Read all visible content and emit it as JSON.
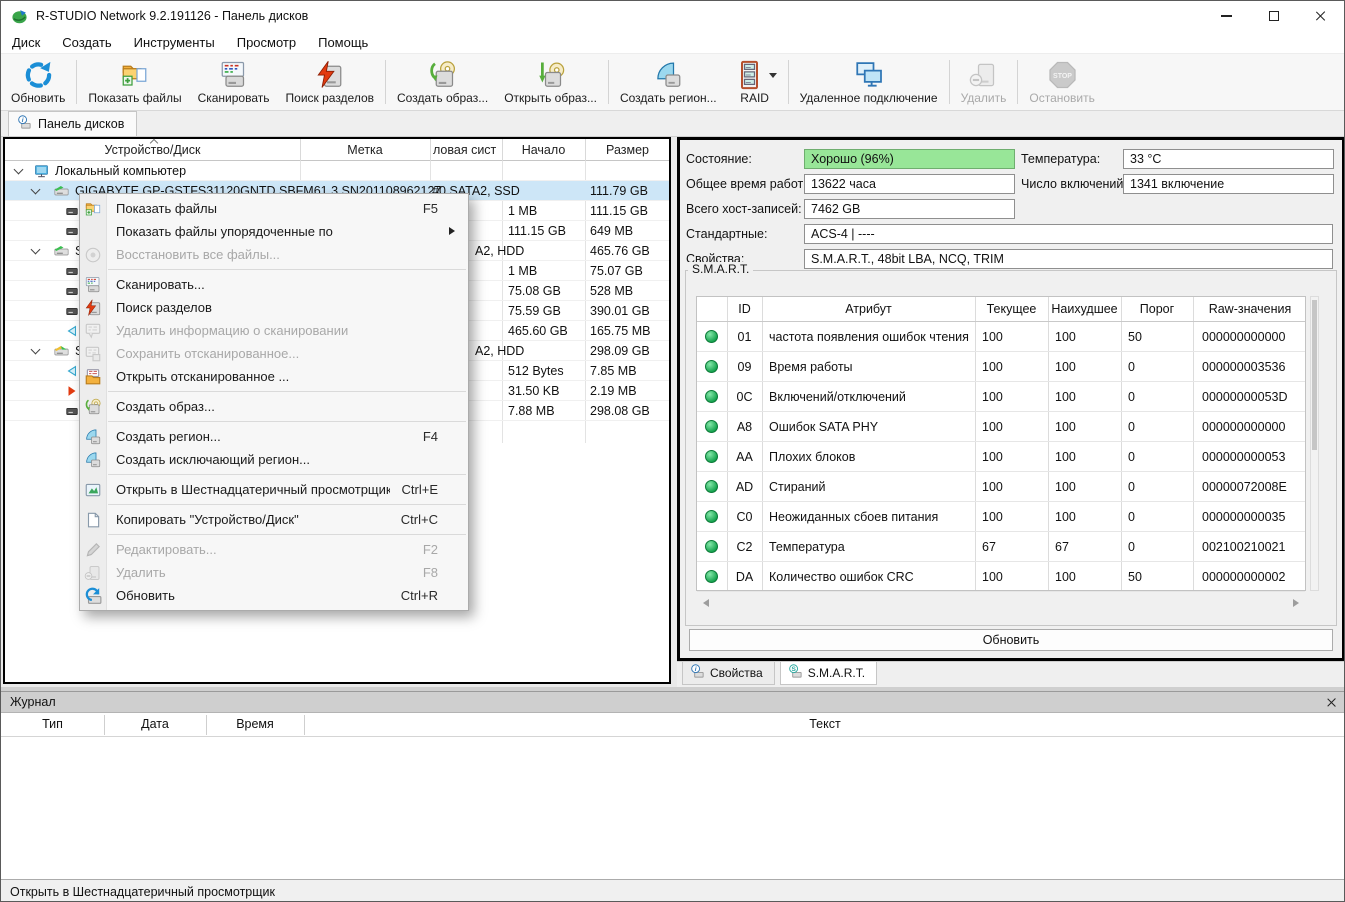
{
  "window": {
    "title": "R-STUDIO Network 9.2.191126 - Панель дисков"
  },
  "menu_bar": [
    "Диск",
    "Создать",
    "Инструменты",
    "Просмотр",
    "Помощь"
  ],
  "toolbar": [
    {
      "label": "Обновить",
      "icon": "refresh-icon",
      "enabled": true,
      "sep_after": true
    },
    {
      "label": "Показать файлы",
      "icon": "show-files-icon",
      "enabled": true
    },
    {
      "label": "Сканировать",
      "icon": "scan-icon",
      "enabled": true
    },
    {
      "label": "Поиск разделов",
      "icon": "find-partitions-icon",
      "enabled": true,
      "sep_after": true
    },
    {
      "label": "Создать образ...",
      "icon": "create-image-icon",
      "enabled": true
    },
    {
      "label": "Открыть образ...",
      "icon": "open-image-icon",
      "enabled": true,
      "sep_after": true
    },
    {
      "label": "Создать регион...",
      "icon": "create-region-icon",
      "enabled": true
    },
    {
      "label": "RAID",
      "icon": "raid-icon",
      "enabled": true,
      "dropdown": true,
      "sep_after": true
    },
    {
      "label": "Удаленное подключение",
      "icon": "remote-connection-icon",
      "enabled": true,
      "sep_after": true
    },
    {
      "label": "Удалить",
      "icon": "delete-icon",
      "enabled": false,
      "sep_after": true
    },
    {
      "label": "Остановить",
      "icon": "stop-icon",
      "enabled": false
    }
  ],
  "panel_tab": "Панель дисков",
  "disk_panel": {
    "columns": [
      "Устройство/Диск",
      "Метка",
      "ловая сист",
      "Начало",
      "Размер"
    ],
    "sort_column": "Устройство/Диск",
    "rows": [
      {
        "label": "Локальный компьютер",
        "depth": 0,
        "icon": "computer-icon",
        "expand": true
      },
      {
        "label": "GIGABYTE GP-GSTFS31120GNTD SBFM61.3 SN201108962127",
        "depth": 1,
        "icon": "drive-green-icon",
        "expand": true,
        "fs": "#0 SATA2, SSD",
        "size": "111.79 GB",
        "selected": true
      },
      {
        "depth": 2,
        "icon": "partition-icon",
        "start": "1 MB",
        "size": "111.15 GB"
      },
      {
        "depth": 2,
        "icon": "partition-icon",
        "start": "111.15 GB",
        "size": "649 MB"
      },
      {
        "label": "S",
        "depth": 1,
        "icon": "drive-green-icon",
        "expand": true,
        "fs": "A2, HDD",
        "size": "465.76 GB"
      },
      {
        "depth": 2,
        "icon": "partition-icon",
        "start": "1 MB",
        "size": "75.07 GB"
      },
      {
        "depth": 2,
        "icon": "partition-icon",
        "start": "75.08 GB",
        "size": "528 MB"
      },
      {
        "depth": 2,
        "icon": "partition-icon",
        "start": "75.59 GB",
        "size": "390.01 GB"
      },
      {
        "depth": 2,
        "icon": "partition-cyan-icon",
        "start": "465.60 GB",
        "size": "165.75 MB"
      },
      {
        "label": "S",
        "depth": 1,
        "icon": "drive-yellow-icon",
        "expand": true,
        "fs": "A2, HDD",
        "size": "298.09 GB"
      },
      {
        "depth": 2,
        "icon": "partition-cyan-icon",
        "start": "512 Bytes",
        "size": "7.85 MB"
      },
      {
        "depth": 2,
        "icon": "partition-red-icon",
        "start": "31.50 KB",
        "size": "2.19 MB"
      },
      {
        "depth": 2,
        "icon": "partition-icon",
        "start": "7.88 MB",
        "size": "298.08 GB"
      }
    ]
  },
  "context_menu": {
    "items": [
      {
        "label": "Показать файлы",
        "shortcut": "F5",
        "icon": "show-files-icon"
      },
      {
        "label": "Показать файлы упорядоченные по",
        "submenu": true
      },
      {
        "label": "Восстановить все файлы...",
        "icon": "recover-all-icon",
        "disabled": true
      },
      {
        "sep": true
      },
      {
        "label": "Сканировать...",
        "icon": "scan-icon"
      },
      {
        "label": "Поиск разделов",
        "icon": "find-partitions-icon"
      },
      {
        "label": "Удалить информацию о сканировании",
        "icon": "remove-scan-info-icon",
        "disabled": true
      },
      {
        "label": "Сохранить отсканированное...",
        "icon": "save-scan-icon",
        "disabled": true
      },
      {
        "label": "Открыть отсканированное ...",
        "icon": "open-scan-icon"
      },
      {
        "sep": true
      },
      {
        "label": "Создать образ...",
        "icon": "create-image-icon"
      },
      {
        "sep": true
      },
      {
        "label": "Создать регион...",
        "shortcut": "F4",
        "icon": "create-region-icon"
      },
      {
        "label": "Создать исключающий регион...",
        "icon": "create-region-icon"
      },
      {
        "sep": true
      },
      {
        "label": "Открыть в Шестнадцатеричный просмотрщик...",
        "shortcut": "Ctrl+E",
        "icon": "hex-viewer-icon"
      },
      {
        "sep": true
      },
      {
        "label": "Копировать \"Устройство/Диск\"",
        "shortcut": "Ctrl+C",
        "icon": "copy-icon"
      },
      {
        "sep": true
      },
      {
        "label": "Редактировать...",
        "shortcut": "F2",
        "icon": "edit-icon",
        "disabled": true
      },
      {
        "label": "Удалить",
        "shortcut": "F8",
        "icon": "delete-icon",
        "disabled": true
      },
      {
        "label": "Обновить",
        "shortcut": "Ctrl+R",
        "icon": "refresh-drive-icon"
      }
    ]
  },
  "smart_panel": {
    "fields": [
      {
        "label": "Состояние:",
        "value": "Хорошо (96%)",
        "green": true
      },
      {
        "label": "Температура:",
        "value": "33 °C"
      },
      {
        "label": "Общее время работы:",
        "value": "13622 часа"
      },
      {
        "label": "Число включений:",
        "value": "1341 включение"
      },
      {
        "label": "Всего хост-записей:",
        "value": "7462 GB"
      },
      {
        "label": "Стандартные:",
        "value": "ACS-4 | ----"
      },
      {
        "label": "Свойства:",
        "value": "S.M.A.R.T., 48bit LBA, NCQ, TRIM"
      }
    ],
    "group_title": "S.M.A.R.T.",
    "table": {
      "columns": [
        "ID",
        "Атрибут",
        "Текущее",
        "Наихудшее",
        "Порог",
        "Raw-значения"
      ],
      "rows": [
        {
          "id": "01",
          "attr": "частота появления ошибок чтения",
          "cur": "100",
          "worst": "100",
          "thr": "50",
          "raw": "000000000000"
        },
        {
          "id": "09",
          "attr": "Время работы",
          "cur": "100",
          "worst": "100",
          "thr": "0",
          "raw": "000000003536"
        },
        {
          "id": "0C",
          "attr": "Включений/отключений",
          "cur": "100",
          "worst": "100",
          "thr": "0",
          "raw": "00000000053D"
        },
        {
          "id": "A8",
          "attr": "Ошибок SATA PHY",
          "cur": "100",
          "worst": "100",
          "thr": "0",
          "raw": "000000000000"
        },
        {
          "id": "AA",
          "attr": "Плохих блоков",
          "cur": "100",
          "worst": "100",
          "thr": "0",
          "raw": "000000000053"
        },
        {
          "id": "AD",
          "attr": "Стираний",
          "cur": "100",
          "worst": "100",
          "thr": "0",
          "raw": "00000072008E"
        },
        {
          "id": "C0",
          "attr": "Неожиданных сбоев питания",
          "cur": "100",
          "worst": "100",
          "thr": "0",
          "raw": "000000000035"
        },
        {
          "id": "C2",
          "attr": "Температура",
          "cur": "67",
          "worst": "67",
          "thr": "0",
          "raw": "002100210021"
        },
        {
          "id": "DA",
          "attr": "Количество ошибок CRC",
          "cur": "100",
          "worst": "100",
          "thr": "50",
          "raw": "000000000002"
        }
      ]
    },
    "refresh_button": "Обновить"
  },
  "bottom_tabs": [
    {
      "label": "Свойства",
      "icon": "properties-icon",
      "active": false
    },
    {
      "label": "S.M.A.R.T.",
      "icon": "smart-icon",
      "active": true
    }
  ],
  "log_panel": {
    "title": "Журнал",
    "columns": [
      "Тип",
      "Дата",
      "Время",
      "Текст"
    ]
  },
  "status_bar": "Открыть в Шестнадцатеричный просмотрщик"
}
